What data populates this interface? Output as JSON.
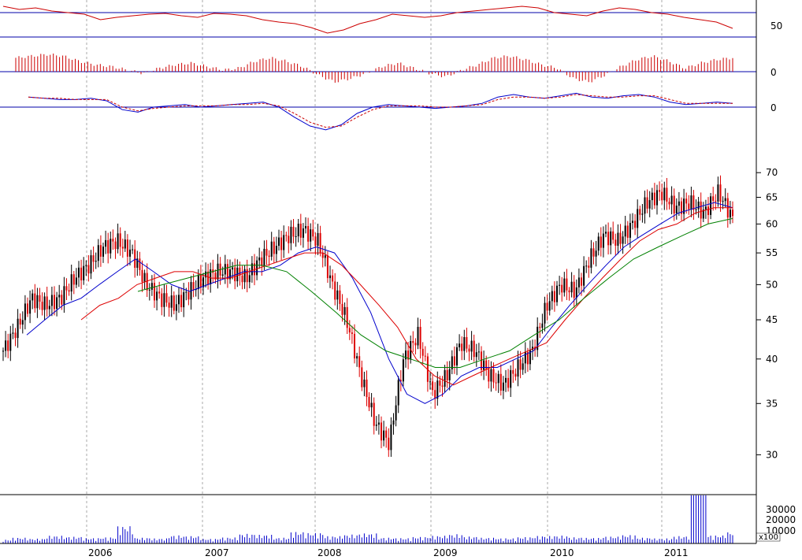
{
  "chart_data": {
    "type": "line",
    "title": "",
    "x_labels": [
      "2006",
      "2007",
      "2008",
      "2009",
      "2010",
      "2011"
    ],
    "grid": "vertical dashed at year boundaries",
    "colors": {
      "price_up": "#000000",
      "price_down": "#dd0000",
      "ma_short": "#0000cc",
      "ma_mid": "#dd0000",
      "ma_long": "#008000",
      "oscillator": "#cc0000",
      "reference_line": "#0000aa",
      "volume": "#0000cc"
    },
    "panels": {
      "rsi": {
        "axis_label": "50",
        "ylim": [
          20,
          80
        ],
        "reference_levels": [
          70,
          50
        ],
        "values": [
          72,
          68,
          70,
          66,
          64,
          62,
          55,
          58,
          60,
          62,
          63,
          60,
          58,
          63,
          62,
          60,
          55,
          52,
          50,
          45,
          38,
          42,
          50,
          55,
          62,
          60,
          58,
          60,
          64,
          66,
          68,
          70,
          72,
          70,
          64,
          62,
          60,
          66,
          70,
          68,
          64,
          62,
          58,
          55,
          52,
          44
        ]
      },
      "histogram": {
        "axis_label": "0",
        "values": [
          8,
          9,
          10,
          9,
          6,
          4,
          3,
          1,
          -1,
          2,
          4,
          5,
          3,
          1,
          2,
          6,
          8,
          6,
          3,
          -2,
          -6,
          -4,
          -1,
          3,
          5,
          2,
          -1,
          -3,
          1,
          4,
          8,
          9,
          7,
          4,
          2,
          -4,
          -6,
          -2,
          3,
          7,
          9,
          6,
          2,
          5,
          7,
          8
        ]
      },
      "macd": {
        "axis_label": "0",
        "macd_values": [
          8,
          7,
          6,
          6,
          7,
          5,
          -2,
          -4,
          0,
          1,
          2,
          0,
          1,
          2,
          3,
          4,
          0,
          -8,
          -15,
          -18,
          -14,
          -5,
          0,
          2,
          1,
          0,
          -1,
          0,
          1,
          3,
          8,
          10,
          8,
          7,
          9,
          11,
          8,
          7,
          9,
          10,
          8,
          4,
          2,
          3,
          4,
          3
        ],
        "signal_values": [
          8,
          7,
          7,
          6,
          6,
          6,
          0,
          -3,
          -1,
          0,
          1,
          1,
          1,
          2,
          2,
          3,
          1,
          -5,
          -12,
          -16,
          -15,
          -8,
          -2,
          1,
          1,
          1,
          0,
          0,
          1,
          2,
          6,
          8,
          8,
          7,
          8,
          10,
          9,
          8,
          8,
          9,
          9,
          6,
          3,
          3,
          3,
          3
        ]
      },
      "price": {
        "scale": "log",
        "ylim": [
          27,
          75
        ],
        "y_ticks": [
          30,
          35,
          40,
          45,
          50,
          55,
          60,
          65,
          70
        ],
        "close": [
          41,
          44,
          48,
          47,
          48,
          51,
          53,
          56,
          57,
          55,
          50,
          48,
          47,
          49,
          51,
          52,
          52,
          51,
          54,
          56,
          58,
          59,
          57,
          50,
          45,
          38,
          33,
          31,
          40,
          43,
          36,
          38,
          42,
          41,
          38,
          37,
          39,
          41,
          47,
          50,
          49,
          54,
          58,
          57,
          60,
          64,
          66,
          63,
          64,
          62,
          66,
          61
        ],
        "ma_short": [
          43,
          45,
          47,
          48,
          50,
          52,
          54,
          52,
          50,
          49,
          50,
          51,
          52,
          52,
          53,
          55,
          56,
          55,
          51,
          46,
          40,
          36,
          35,
          36,
          38,
          39,
          39,
          40,
          41,
          44,
          47,
          50,
          53,
          56,
          58,
          60,
          62,
          63,
          64,
          63
        ],
        "ma_mid": [
          45,
          47,
          48,
          50,
          51,
          52,
          52,
          51,
          51,
          52,
          53,
          54,
          55,
          55,
          53,
          50,
          47,
          44,
          40,
          38,
          37,
          38,
          39,
          40,
          41,
          42,
          45,
          48,
          51,
          54,
          57,
          59,
          60,
          62,
          63,
          63
        ],
        "ma_long": [
          49,
          50,
          51,
          52,
          53,
          53,
          52,
          49,
          46,
          43,
          41,
          40,
          39,
          39,
          40,
          41,
          43,
          45,
          48,
          51,
          54,
          56,
          58,
          60,
          61
        ]
      },
      "volume": {
        "y_ticks": [
          "30000",
          "20000",
          "10000"
        ],
        "unit_label": "x100",
        "values": [
          2000,
          3000,
          2500,
          4000,
          3500,
          2800,
          3200,
          9000,
          3000,
          2600,
          4200,
          3800,
          2400,
          3100,
          5000,
          4500,
          3000,
          6000,
          5500,
          3800,
          4600,
          5200,
          3000,
          2800,
          3400,
          4000,
          4800,
          3600,
          3000,
          2700,
          3300,
          3900,
          4100,
          3200,
          2900,
          3600,
          4400,
          3000,
          2600,
          3800,
          35000,
          4200,
          6000
        ]
      }
    }
  }
}
